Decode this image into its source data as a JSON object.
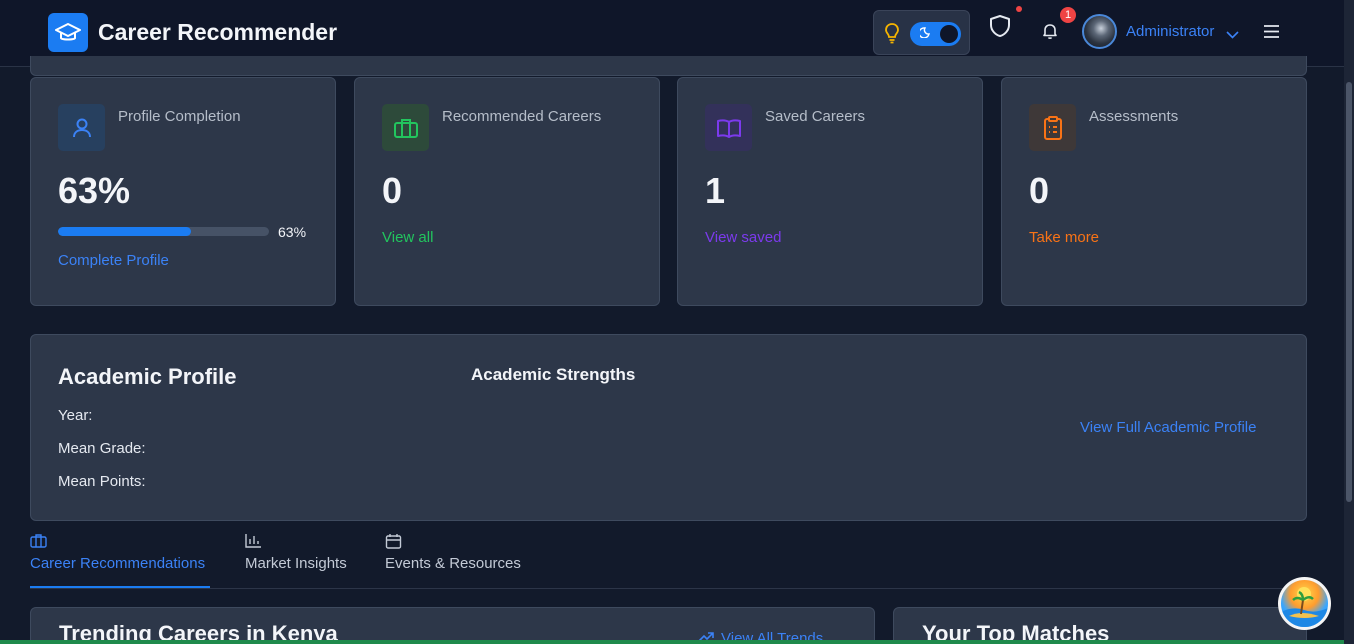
{
  "header": {
    "title": "Career Recommender",
    "user_name": "Administrator",
    "notification_count": "1",
    "theme_mode": "dark"
  },
  "stats": [
    {
      "title": "Profile Completion",
      "value": "63%",
      "progress_percent": 63,
      "progress_label": "63%",
      "link": "Complete Profile",
      "accent": "#3b82f6",
      "icon": "user-icon"
    },
    {
      "title": "Recommended Careers",
      "value": "0",
      "link": "View all",
      "accent": "#22c55e",
      "icon": "briefcase-icon"
    },
    {
      "title": "Saved Careers",
      "value": "1",
      "link": "View saved",
      "accent": "#7c3aed",
      "icon": "book-icon"
    },
    {
      "title": "Assessments",
      "value": "0",
      "link": "Take more",
      "accent": "#f97316",
      "icon": "clipboard-icon"
    }
  ],
  "academic": {
    "title": "Academic Profile",
    "year_label": "Year:",
    "mean_grade_label": "Mean Grade:",
    "mean_points_label": "Mean Points:",
    "strengths_title": "Academic Strengths",
    "view_link": "View Full Academic Profile"
  },
  "tabs": [
    {
      "label": "Career Recommendations",
      "active": true,
      "icon": "briefcase-icon"
    },
    {
      "label": "Market Insights",
      "active": false,
      "icon": "bar-chart-icon"
    },
    {
      "label": "Events & Resources",
      "active": false,
      "icon": "calendar-icon"
    }
  ],
  "trending": {
    "title": "Trending Careers in Kenya",
    "link": "View All Trends"
  },
  "matches": {
    "title": "Your Top Matches"
  },
  "colors": {
    "accent": "#1b7cf2",
    "background": "#121a2b",
    "card": "#2d3749"
  }
}
